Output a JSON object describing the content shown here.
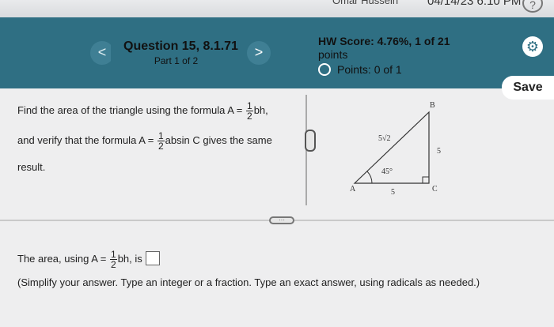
{
  "topbar": {
    "user": "Omar Hussein",
    "timestamp": "04/14/23 6:10 PM",
    "help_icon": "?"
  },
  "header": {
    "prev_icon": "<",
    "next_icon": ">",
    "question_title": "Question 15, 8.1.71",
    "part_label": "Part 1 of 2",
    "hw_score": "HW Score: 4.76%, 1 of 21",
    "hw_points_word": "points",
    "points_label": "Points: 0 of 1",
    "save_label": "Save",
    "gear_icon": "⚙"
  },
  "question": {
    "line1_pre": "Find the area of the triangle using the formula A =",
    "line1_num": "1",
    "line1_den": "2",
    "line1_post": "bh,",
    "line2_pre": "and verify that the formula A =",
    "line2_num": "1",
    "line2_den": "2",
    "line2_post": "absin C gives the same",
    "line3": "result."
  },
  "figure": {
    "label_A": "A",
    "label_B": "B",
    "label_C": "C",
    "hyp": "5√2",
    "angle": "45°",
    "side_right": "5",
    "side_bottom": "5"
  },
  "answer": {
    "pre": "The area, using A =",
    "num": "1",
    "den": "2",
    "post": "bh, is",
    "hint": "(Simplify your answer. Type an integer or a fraction. Type an exact answer, using radicals as needed.)"
  }
}
